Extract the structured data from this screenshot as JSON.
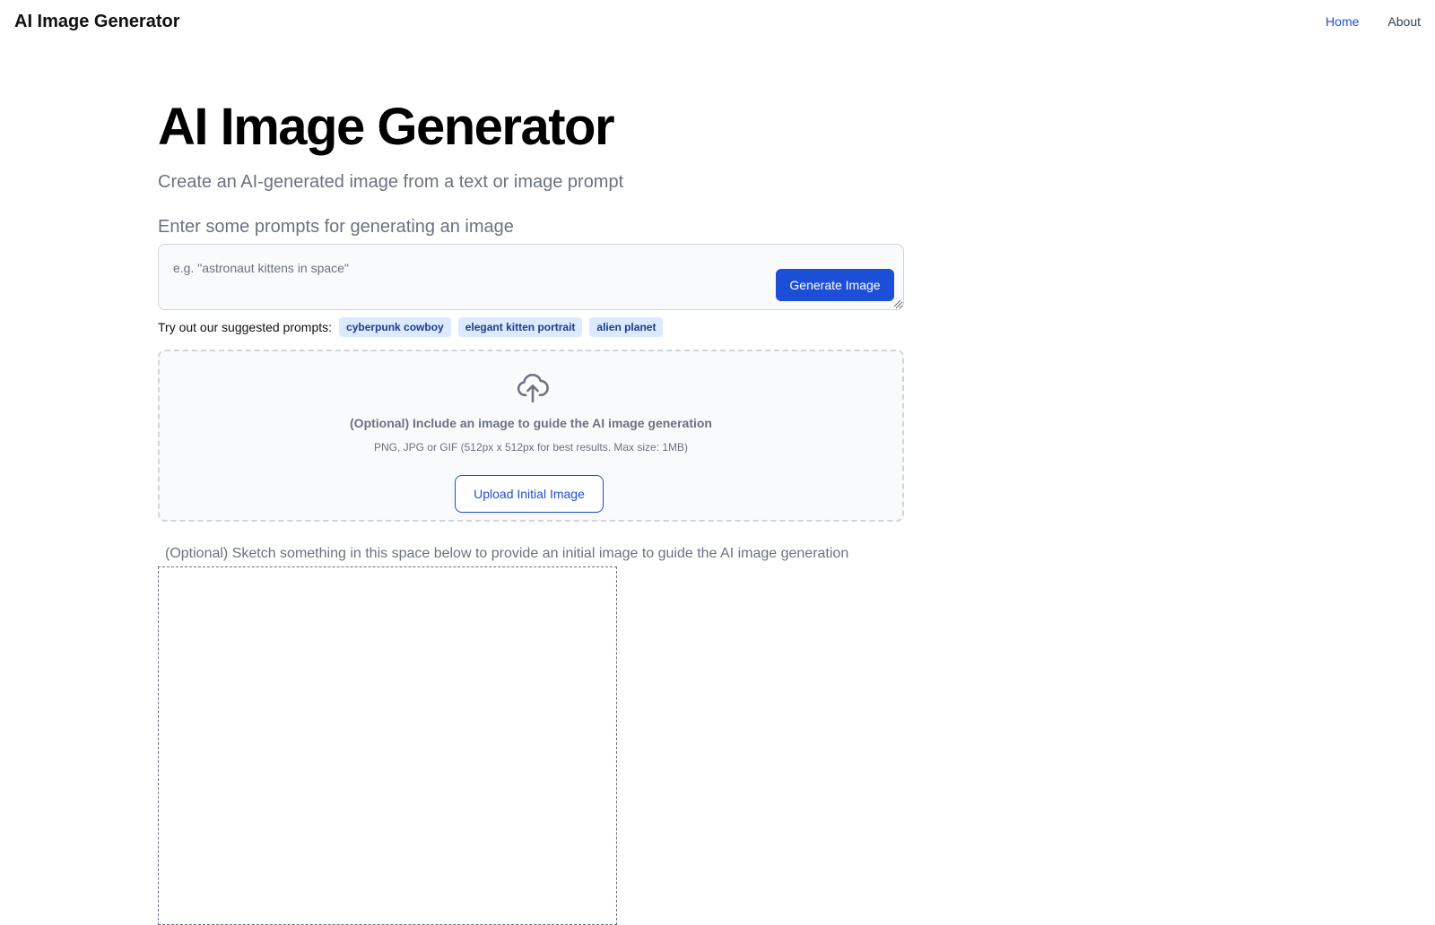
{
  "app": {
    "brand": "AI Image Generator",
    "nav": {
      "home": "Home",
      "about": "About"
    }
  },
  "colors": {
    "accent": "#1d4ed8",
    "chip_bg": "#dbeafe",
    "chip_text": "#1e3a8a",
    "muted_text": "#6b7280"
  },
  "hero": {
    "title": "AI Image Generator",
    "subtitle": "Create an AI-generated image from a text or image prompt"
  },
  "prompt": {
    "label": "Enter some prompts for generating an image",
    "placeholder": "e.g. \"astronaut kittens in space\"",
    "value": "",
    "generate_label": "Generate Image"
  },
  "suggestions": {
    "label": "Try out our suggested prompts:",
    "items": [
      "cyberpunk cowboy",
      "elegant kitten portrait",
      "alien planet"
    ]
  },
  "upload": {
    "icon": "cloud-upload-icon",
    "title": "(Optional) Include an image to guide the AI image generation",
    "hint": "PNG, JPG or GIF (512px x 512px for best results. Max size: 1MB)",
    "button_label": "Upload Initial Image"
  },
  "sketch": {
    "label": "(Optional) Sketch something in this space below to provide an initial image to guide the AI image generation"
  }
}
